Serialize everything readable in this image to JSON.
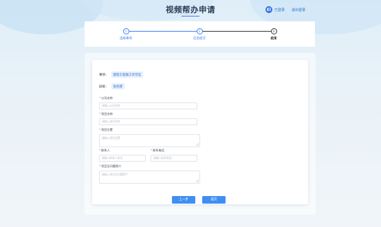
{
  "header": {
    "title": "视频帮办申请",
    "user": {
      "avatar_text": "El",
      "name": "已登录",
      "logout_label": "退出登录"
    }
  },
  "steps": [
    {
      "number": "1",
      "label": "选择事项",
      "state": "active"
    },
    {
      "number": "2",
      "label": "信息提交",
      "state": "active"
    },
    {
      "number": "3",
      "label": "结束",
      "state": "current"
    }
  ],
  "form": {
    "matter": {
      "label": "事项：",
      "value": "建筑工程施工许可证"
    },
    "dept": {
      "label": "层级：",
      "value": "省住建"
    },
    "fields": {
      "company_name": {
        "label": "公司名称",
        "placeholder": "请输入公司名称",
        "required": true
      },
      "project_name": {
        "label": "项目名称",
        "placeholder": "请输入项目名称",
        "required": true
      },
      "project_location": {
        "label": "项目位置",
        "placeholder": "请输入项目位置",
        "required": true
      },
      "contact": {
        "label": "联系人",
        "placeholder": "请输入联系人姓名",
        "required": true
      },
      "phone": {
        "label": "联系电话",
        "placeholder": "请输入联系电话",
        "required": true
      },
      "description": {
        "label": "项目及问题简介",
        "placeholder": "请输入项目及问题简介",
        "required": true
      }
    },
    "buttons": {
      "prev": "上一步",
      "submit": "提交"
    }
  },
  "colors": {
    "accent": "#3b82f6",
    "button": "#3f8ff2",
    "required": "#e35d5d"
  }
}
